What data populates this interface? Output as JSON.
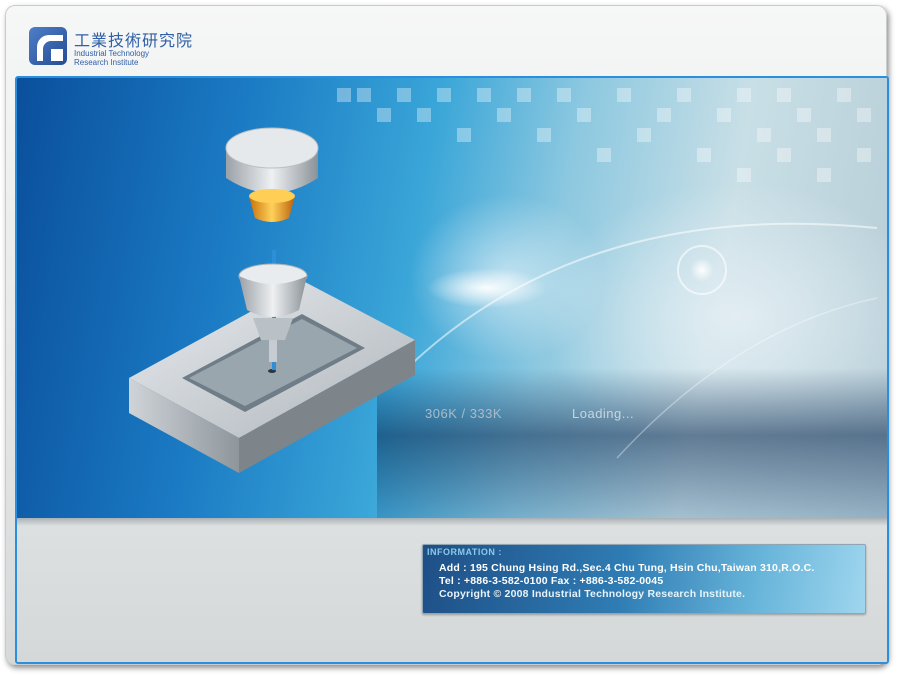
{
  "header": {
    "logo_cn": "工業技術研究院",
    "logo_en_line1": "Industrial Technology",
    "logo_en_line2": "Research Institute"
  },
  "loader": {
    "progress_text": "306K / 333K",
    "loaded_kb": 306,
    "total_kb": 333,
    "status_text": "Loading..."
  },
  "info": {
    "title": "INFORMATION :",
    "address": "Add : 195 Chung Hsing Rd.,Sec.4 Chu Tung, Hsin Chu,Taiwan 310,R.O.C.",
    "tel_fax": "Tel : +886-3-582-0100    Fax : +886-3-582-0045",
    "copyright": "Copyright © 2008 Industrial Technology Research Institute."
  },
  "colors": {
    "frame_border": "#2b8fe0",
    "brand_blue": "#2f5fa5",
    "banner_deep": "#0a4f9c"
  },
  "icons": {
    "logo": "itri-logo-icon",
    "illustration": "machining-tool-illustration"
  }
}
